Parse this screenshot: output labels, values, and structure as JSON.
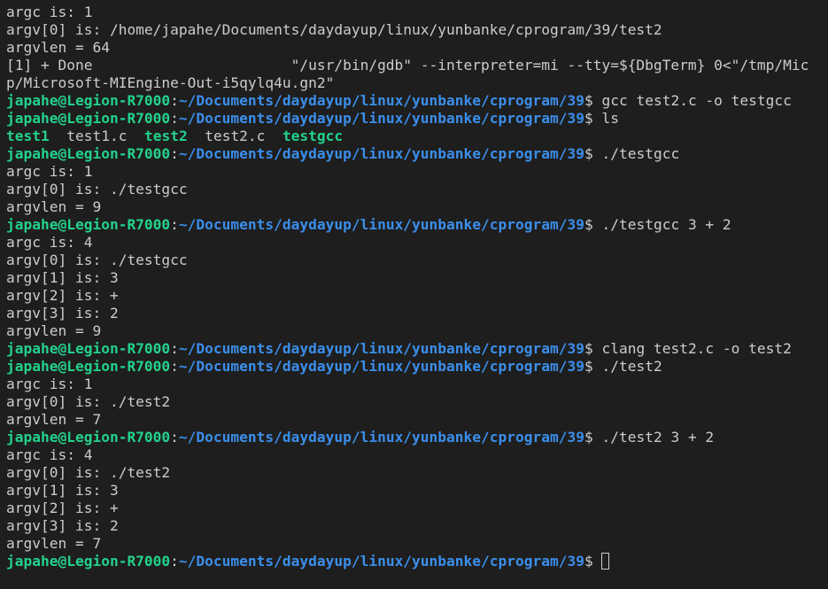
{
  "colors": {
    "background": "#1e1e1e",
    "text": "#cccccc",
    "prompt_user": "#23d18b",
    "prompt_path": "#3b8eea",
    "executable": "#23d18b"
  },
  "prompt": {
    "user": "japahe@Legion-R7000",
    "sep": ":",
    "path": "~/Documents/daydayup/linux/yunbanke/cprogram/39",
    "sigil": "$ "
  },
  "lines": [
    {
      "type": "out",
      "text": "argc is: 1"
    },
    {
      "type": "out",
      "text": "argv[0] is: /home/japahe/Documents/daydayup/linux/yunbanke/cprogram/39/test2"
    },
    {
      "type": "out",
      "text": "argvlen = 64"
    },
    {
      "type": "out",
      "text": "[1] + Done                       \"/usr/bin/gdb\" --interpreter=mi --tty=${DbgTerm} 0<\"/tmp/Mic"
    },
    {
      "type": "out",
      "text": "p/Microsoft-MIEngine-Out-i5qylq4u.gn2\""
    },
    {
      "type": "cmd",
      "cmd": "gcc test2.c -o testgcc"
    },
    {
      "type": "cmd",
      "cmd": "ls"
    },
    {
      "type": "ls",
      "items": [
        {
          "text": "test1",
          "exec": true
        },
        {
          "text": "  ",
          "exec": false
        },
        {
          "text": "test1.c",
          "exec": false
        },
        {
          "text": "  ",
          "exec": false
        },
        {
          "text": "test2",
          "exec": true
        },
        {
          "text": "  ",
          "exec": false
        },
        {
          "text": "test2.c",
          "exec": false
        },
        {
          "text": "  ",
          "exec": false
        },
        {
          "text": "testgcc",
          "exec": true
        }
      ]
    },
    {
      "type": "cmd",
      "cmd": "./testgcc"
    },
    {
      "type": "out",
      "text": "argc is: 1"
    },
    {
      "type": "out",
      "text": "argv[0] is: ./testgcc"
    },
    {
      "type": "out",
      "text": "argvlen = 9"
    },
    {
      "type": "cmd",
      "cmd": "./testgcc 3 + 2"
    },
    {
      "type": "out",
      "text": "argc is: 4"
    },
    {
      "type": "out",
      "text": "argv[0] is: ./testgcc"
    },
    {
      "type": "out",
      "text": "argv[1] is: 3"
    },
    {
      "type": "out",
      "text": "argv[2] is: +"
    },
    {
      "type": "out",
      "text": "argv[3] is: 2"
    },
    {
      "type": "out",
      "text": "argvlen = 9"
    },
    {
      "type": "cmd",
      "cmd": "clang test2.c -o test2"
    },
    {
      "type": "cmd",
      "cmd": "./test2"
    },
    {
      "type": "out",
      "text": "argc is: 1"
    },
    {
      "type": "out",
      "text": "argv[0] is: ./test2"
    },
    {
      "type": "out",
      "text": "argvlen = 7"
    },
    {
      "type": "cmd",
      "cmd": "./test2 3 + 2"
    },
    {
      "type": "out",
      "text": "argc is: 4"
    },
    {
      "type": "out",
      "text": "argv[0] is: ./test2"
    },
    {
      "type": "out",
      "text": "argv[1] is: 3"
    },
    {
      "type": "out",
      "text": "argv[2] is: +"
    },
    {
      "type": "out",
      "text": "argv[3] is: 2"
    },
    {
      "type": "out",
      "text": "argvlen = 7"
    },
    {
      "type": "cmd",
      "cmd": "",
      "cursor": true
    }
  ]
}
